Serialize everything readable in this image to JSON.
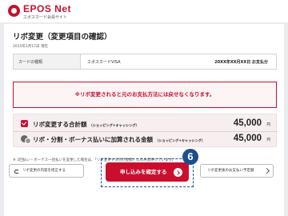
{
  "header": {
    "logo_text": "EPOS Net",
    "logo_subtext": "エポスカード会員サイト"
  },
  "page": {
    "title": "リボ変更（変更項目の確認）",
    "date": "2015年1月17日 現在"
  },
  "info": {
    "label": "カードの種類",
    "card_name": "エポスカードVISA",
    "card_number": "20XX年XX月XX日 お支払分"
  },
  "warning": {
    "text": "※リボ変更されると元のお支払方法には戻せなくなります。"
  },
  "totals": {
    "row1": {
      "label": "リボ変更する合計額",
      "note": "（ショッピング+キャッシング）",
      "amount": "45,000",
      "unit": "円"
    },
    "row2": {
      "label": "リボ・分割・ボーナス払いに加算される金額",
      "note": "（ショッピング+キャッシング）",
      "amount": "45,000",
      "unit": "円"
    }
  },
  "note": {
    "text": "※ 2回払い・ボーナス一括払いを変更した場合は、「リボ変更する合計金額」にのみ反映しています。"
  },
  "buttons": {
    "back_label": "リボ変更の内容を修正する",
    "confirm_label": "申し込みを確定する",
    "next_label": "リボ変更後のお支払い予定額"
  },
  "step_badge": "6",
  "colors": {
    "brand": "#c8102e",
    "highlight": "#1f4e8c"
  }
}
